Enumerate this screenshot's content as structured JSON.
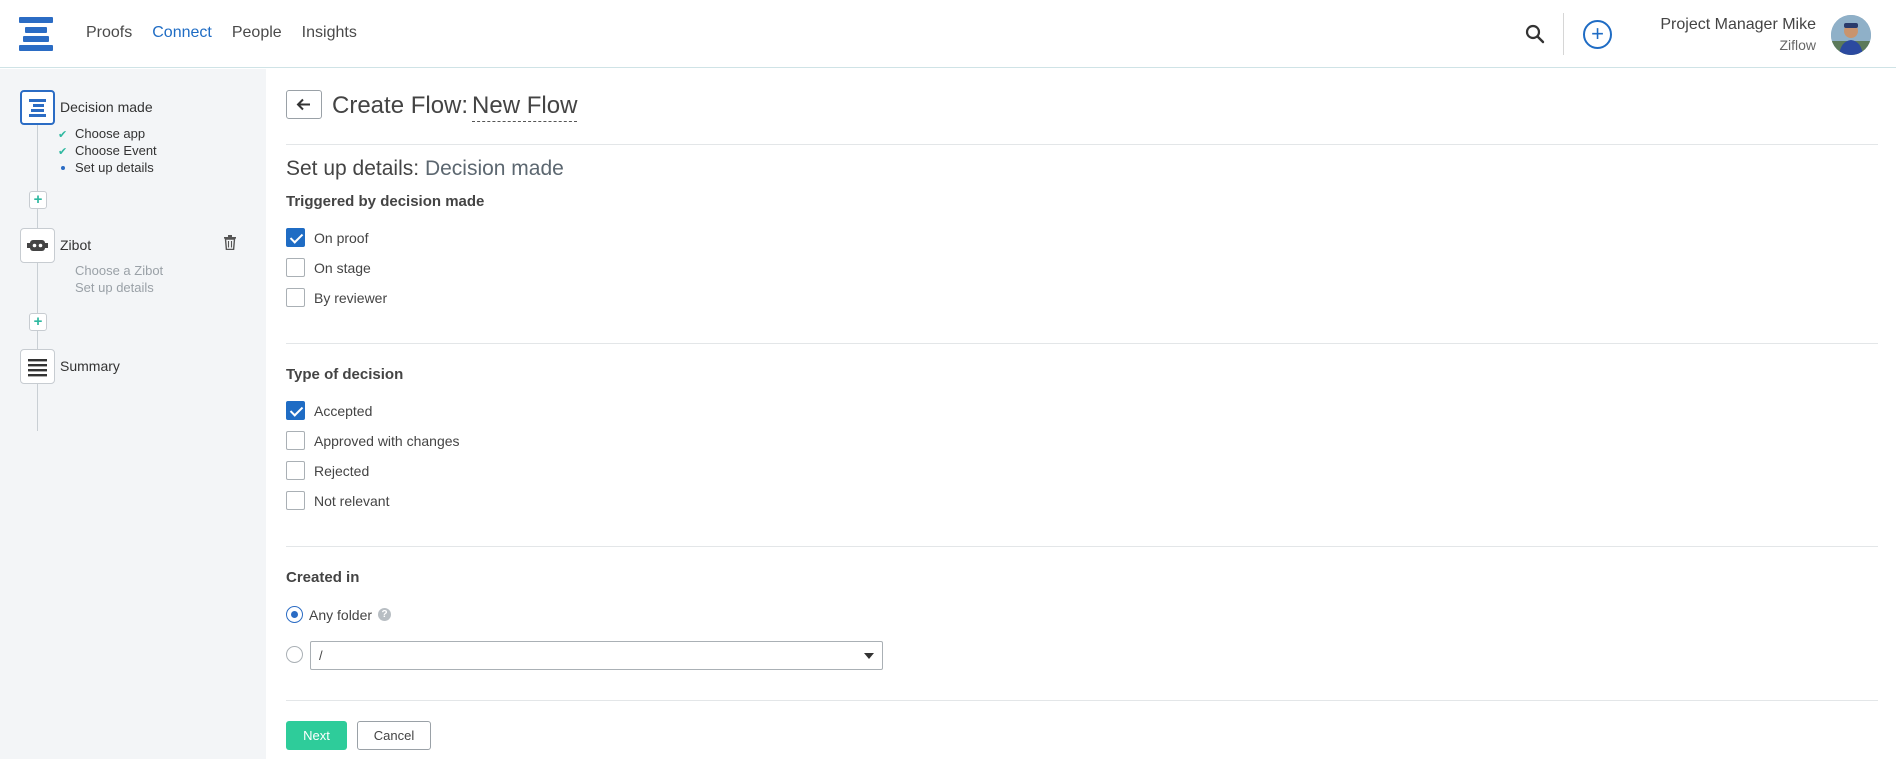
{
  "nav": {
    "items": [
      {
        "label": "Proofs"
      },
      {
        "label": "Connect"
      },
      {
        "label": "People"
      },
      {
        "label": "Insights"
      }
    ],
    "active": "Connect",
    "accent_color": "#1f6cc4"
  },
  "user": {
    "name": "Project Manager Mike",
    "org": "Ziflow"
  },
  "sidebar": {
    "steps": [
      {
        "title": "Decision made",
        "icon": "flow-trigger-icon",
        "subitems": [
          {
            "label": "Choose app",
            "status": "done"
          },
          {
            "label": "Choose Event",
            "status": "done"
          },
          {
            "label": "Set up details",
            "status": "current"
          }
        ]
      },
      {
        "title": "Zibot",
        "icon": "robot-icon",
        "subitems": [
          {
            "label": "Choose a Zibot",
            "status": "pending"
          },
          {
            "label": "Set up details",
            "status": "pending"
          }
        ]
      },
      {
        "title": "Summary",
        "icon": "summary-list-icon"
      }
    ]
  },
  "page": {
    "title_prefix": "Create Flow:",
    "flow_name": "New Flow",
    "section_title": "Set up details:",
    "section_subject": "Decision made"
  },
  "triggered": {
    "label": "Triggered by decision made",
    "options": [
      {
        "label": "On proof",
        "checked": true
      },
      {
        "label": "On stage",
        "checked": false
      },
      {
        "label": "By reviewer",
        "checked": false
      }
    ]
  },
  "decision_type": {
    "label": "Type of decision",
    "options": [
      {
        "label": "Accepted",
        "checked": true
      },
      {
        "label": "Approved with changes",
        "checked": false
      },
      {
        "label": "Rejected",
        "checked": false
      },
      {
        "label": "Not relevant",
        "checked": false
      }
    ]
  },
  "created_in": {
    "label": "Created in",
    "any_folder_label": "Any folder",
    "selected": "any_folder",
    "folder_value": "/"
  },
  "actions": {
    "next_label": "Next",
    "cancel_label": "Cancel",
    "next_color": "#2ecc9a"
  }
}
